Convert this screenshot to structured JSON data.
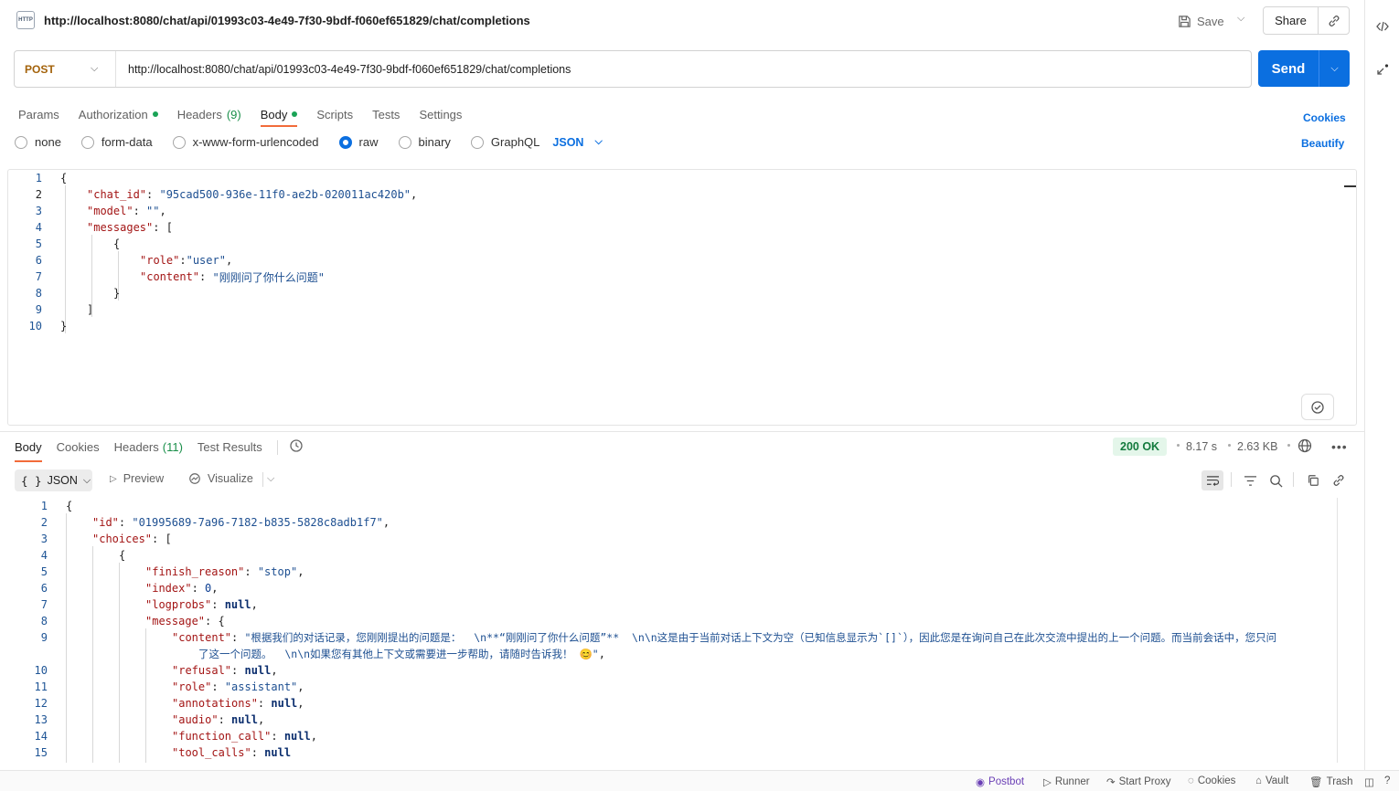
{
  "header": {
    "badge": "HTTP",
    "title": "http://localhost:8080/chat/api/01993c03-4e49-7f30-9bdf-f060ef651829/chat/completions",
    "save_label": "Save",
    "share_label": "Share"
  },
  "request": {
    "method": "POST",
    "url": "http://localhost:8080/chat/api/01993c03-4e49-7f30-9bdf-f060ef651829/chat/completions",
    "send_label": "Send",
    "method_color": "#a3620a",
    "send_color": "#0b6fe0"
  },
  "req_tabs": [
    {
      "label": "Params"
    },
    {
      "label": "Authorization"
    },
    {
      "label": "Headers",
      "count": "(9)"
    },
    {
      "label": "Body"
    },
    {
      "label": "Scripts"
    },
    {
      "label": "Tests"
    },
    {
      "label": "Settings"
    }
  ],
  "cookies_label": "Cookies",
  "beautify_label": "Beautify",
  "body_types": [
    {
      "label": "none",
      "selected": false
    },
    {
      "label": "form-data",
      "selected": false
    },
    {
      "label": "x-www-form-urlencoded",
      "selected": false
    },
    {
      "label": "raw",
      "selected": true
    },
    {
      "label": "binary",
      "selected": false
    },
    {
      "label": "GraphQL",
      "selected": false
    }
  ],
  "raw_format": "JSON",
  "request_body": {
    "chat_id": "\"95cad500-936e-11f0-ae2b-020011ac420b\"",
    "model": "\"\"",
    "role": "\"user\"",
    "content": "\"刚刚问了你什么问题\""
  },
  "response": {
    "tabs": [
      {
        "label": "Body"
      },
      {
        "label": "Cookies"
      },
      {
        "label": "Headers",
        "count": "(11)"
      },
      {
        "label": "Test Results"
      }
    ],
    "status": "200 OK",
    "time": "8.17 s",
    "size": "2.63 KB",
    "format": "JSON",
    "preview_label": "Preview",
    "visualize_label": "Visualize",
    "status_color": "#137a3d"
  },
  "response_body": {
    "id": "\"01995689-7a96-7182-b835-5828c8adb1f7\"",
    "finish_reason": "\"stop\"",
    "index": "0",
    "logprobs": "null",
    "content_line1": "\"根据我们的对话记录，您刚刚提出的问题是：  \\n**“刚刚问了你什么问题”**  \\n\\n这是由于当前对话上下文为空（已知信息显示为`[]`），因此您是在询问自己在此次交流中提出的上一个问题。而当前会话中，您只问",
    "content_line2": "了这一个问题。  \\n\\n如果您有其他上下文或需要进一步帮助，请随时告诉我！ 😊\"",
    "refusal": "null",
    "role": "\"assistant\"",
    "annotations": "null",
    "audio": "null",
    "function_call": "null",
    "tool_calls": "null"
  },
  "statusbar": {
    "postbot": "Postbot",
    "runner": "Runner",
    "proxy": "Start Proxy",
    "cookies": "Cookies",
    "vault": "Vault",
    "trash": "Trash"
  }
}
